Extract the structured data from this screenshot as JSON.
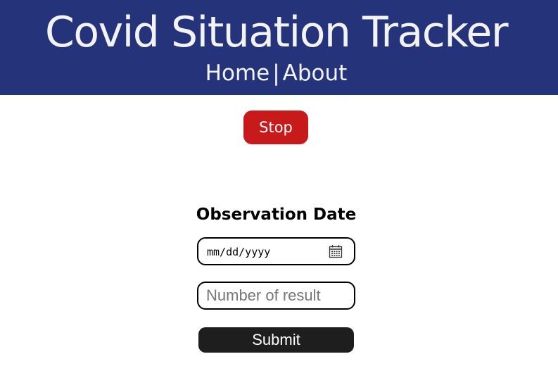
{
  "header": {
    "title": "Covid Situation Tracker",
    "nav": {
      "home": "Home",
      "separator": "|",
      "about": "About"
    }
  },
  "controls": {
    "stop_label": "Stop"
  },
  "form": {
    "heading": "Observation Date",
    "date_placeholder": "mm/dd/yyyy",
    "result_placeholder": "Number of result",
    "result_value": "",
    "submit_label": "Submit"
  },
  "icons": {
    "date_picker": "calendar-icon"
  },
  "colors": {
    "header_bg": "#25347a",
    "header_text": "#f3f3f6",
    "stop_button": "#c8191b",
    "submit_button": "#1e1e1e",
    "field_border": "#000000"
  }
}
